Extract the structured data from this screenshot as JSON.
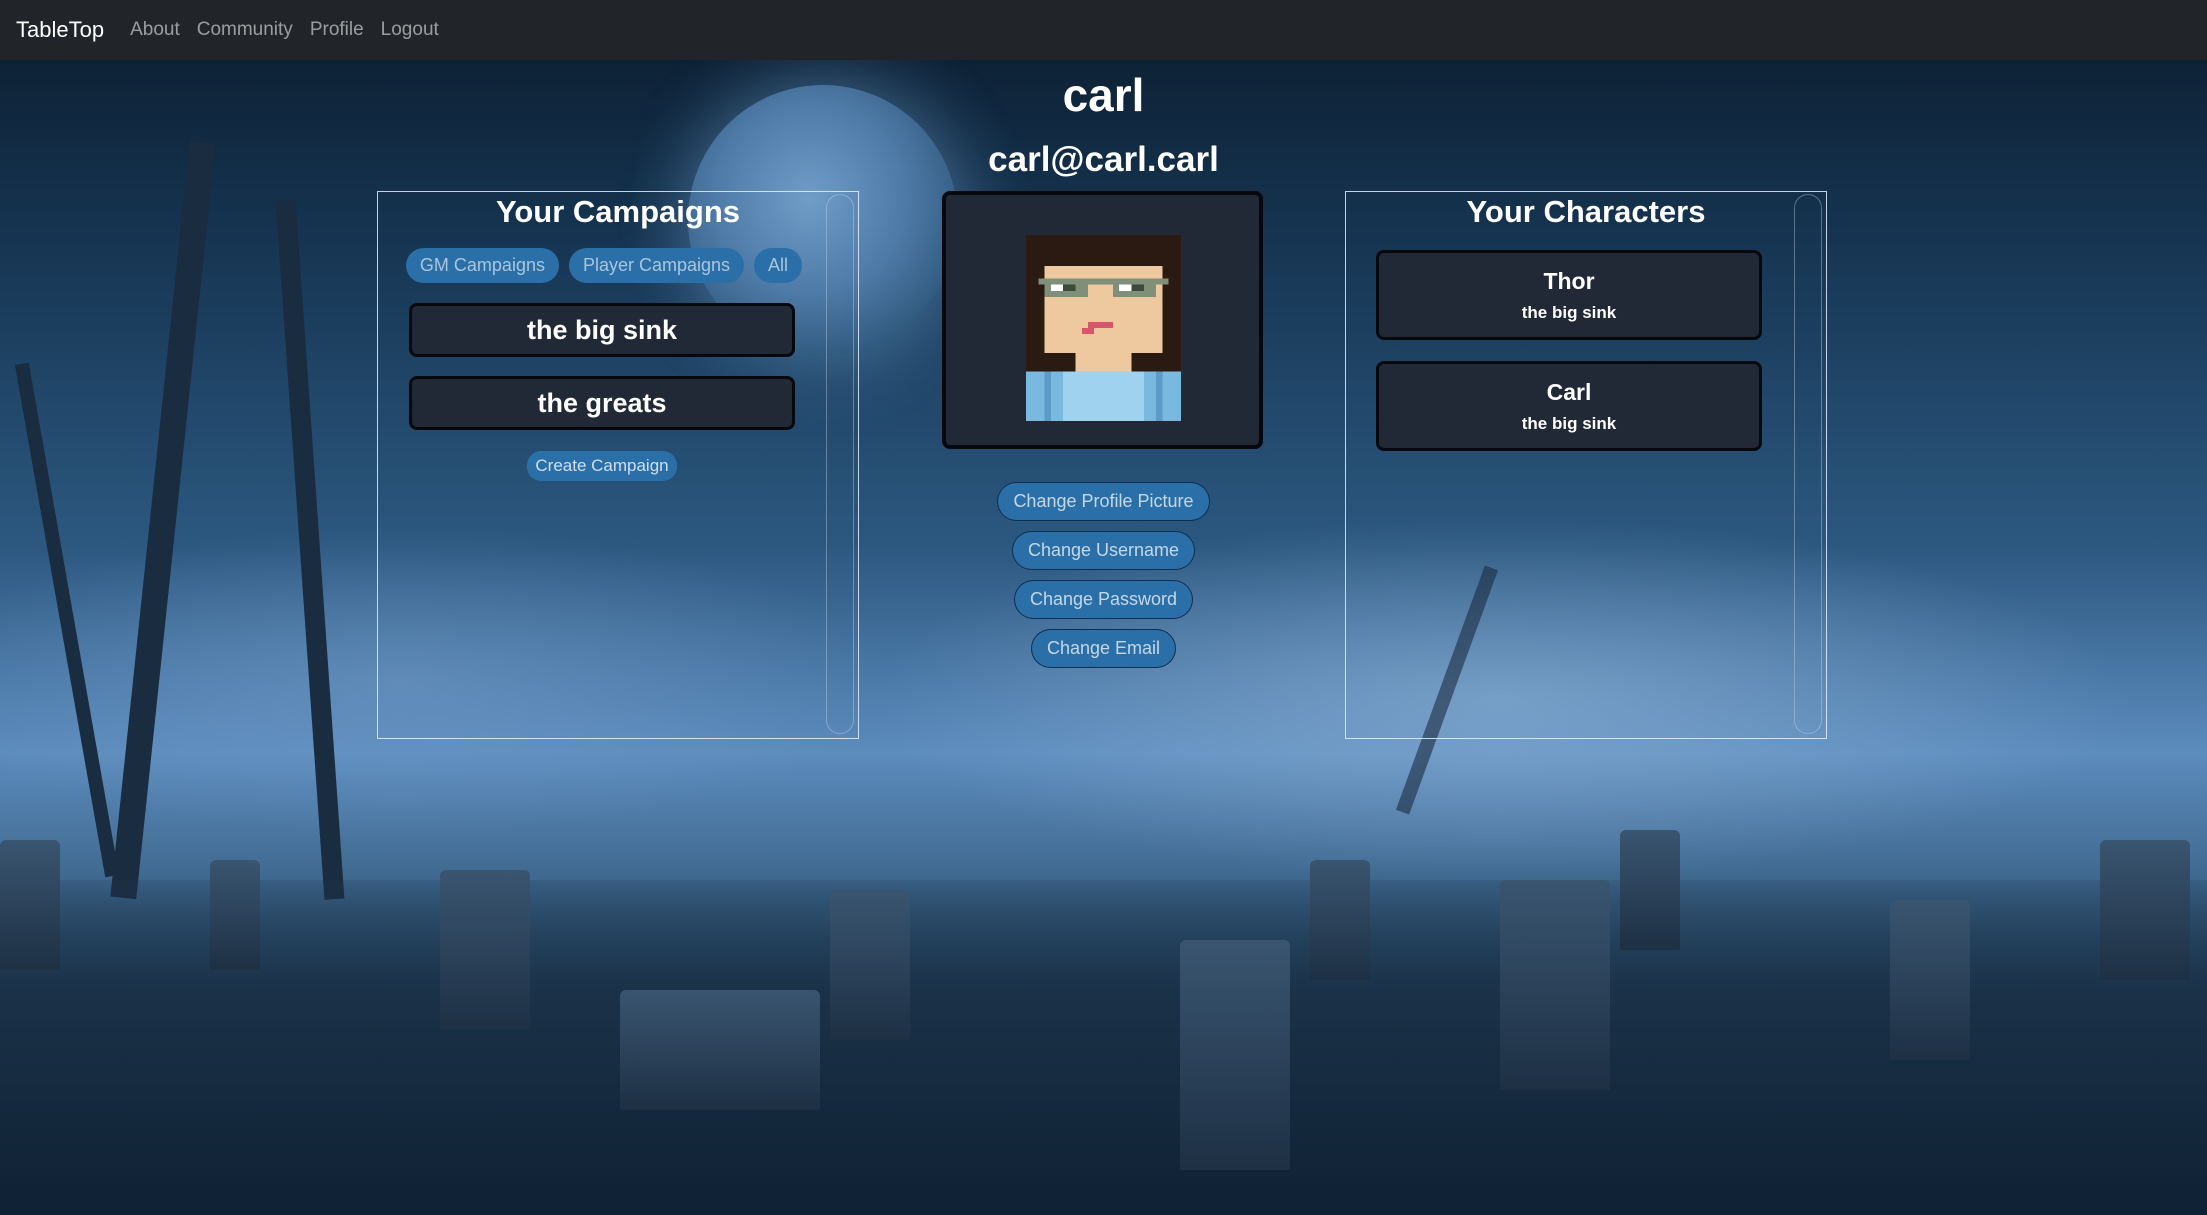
{
  "nav": {
    "brand": "TableTop",
    "links": [
      "About",
      "Community",
      "Profile",
      "Logout"
    ]
  },
  "profile": {
    "username": "carl",
    "email": "carl@carl.carl"
  },
  "campaigns": {
    "title": "Your Campaigns",
    "filters": [
      "GM Campaigns",
      "Player Campaigns",
      "All"
    ],
    "items": [
      "the big sink",
      "the greats"
    ],
    "create_label": "Create Campaign"
  },
  "characters": {
    "title": "Your Characters",
    "items": [
      {
        "name": "Thor",
        "campaign": "the big sink"
      },
      {
        "name": "Carl",
        "campaign": "the big sink"
      }
    ]
  },
  "actions": [
    "Change Profile Picture",
    "Change Username",
    "Change Password",
    "Change Email"
  ],
  "colors": {
    "navbar": "#212529",
    "button": "#2a6fa8",
    "card": "#212836",
    "card_border": "#05080d"
  },
  "background": {
    "scene": "foggy-graveyard-moon"
  }
}
